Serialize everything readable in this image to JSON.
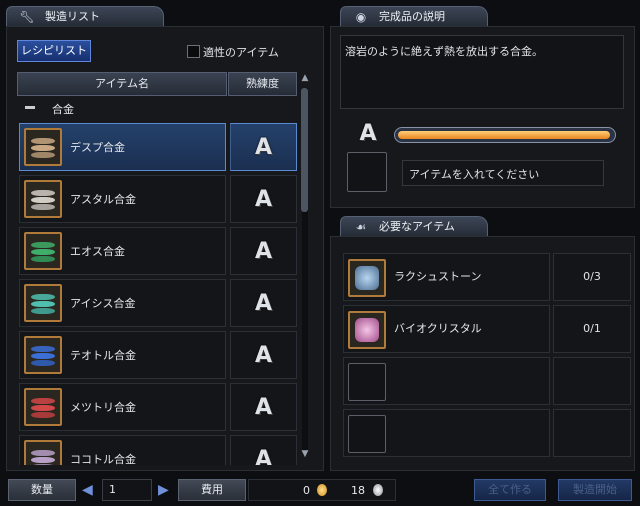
{
  "recipe_panel": {
    "tab_title": "製造リスト",
    "tab_icon": "wrench-icon",
    "recipe_list_button": "レシピリスト",
    "filter_label": "適性のアイテム",
    "col_item_name": "アイテム名",
    "col_proficiency": "熟練度",
    "category_label": "合金",
    "items": [
      {
        "name": "デスプ合金",
        "grade": "A",
        "selected": true,
        "color": "#c8a882"
      },
      {
        "name": "アスタル合金",
        "grade": "A",
        "selected": false,
        "color": "#d2cdc4"
      },
      {
        "name": "エオス合金",
        "grade": "A",
        "selected": false,
        "color": "#3fae6a"
      },
      {
        "name": "アイシス合金",
        "grade": "A",
        "selected": false,
        "color": "#4fc0b0"
      },
      {
        "name": "テオトル合金",
        "grade": "A",
        "selected": false,
        "color": "#3b6fd6"
      },
      {
        "name": "メツトリ合金",
        "grade": "A",
        "selected": false,
        "color": "#d24848"
      },
      {
        "name": "ココトル合金",
        "grade": "A",
        "selected": false,
        "color": "#b9a0c8"
      }
    ]
  },
  "description_panel": {
    "tab_title": "完成品の説明",
    "tab_icon": "info-icon",
    "text": "溶岩のように絶えず熱を放出する合金。",
    "grade": "A",
    "progress": 1.0,
    "slot_placeholder": "アイテムを入れてください"
  },
  "required_panel": {
    "tab_title": "必要なアイテム",
    "tab_icon": "bag-icon",
    "items": [
      {
        "name": "ラクシュストーン",
        "count": "0/3"
      },
      {
        "name": "バイオクリスタル",
        "count": "0/1"
      },
      {
        "name": "",
        "count": ""
      },
      {
        "name": "",
        "count": ""
      }
    ]
  },
  "footer": {
    "quantity_label": "数量",
    "quantity_value": "1",
    "cost_label": "費用",
    "gold_cost": "0",
    "silver_cost": "18",
    "make_all_button": "全て作る",
    "start_button": "製造開始"
  },
  "colors": {
    "accent": "#5f86d8",
    "progress": "#f0a030",
    "frame": "#b07a3a"
  }
}
